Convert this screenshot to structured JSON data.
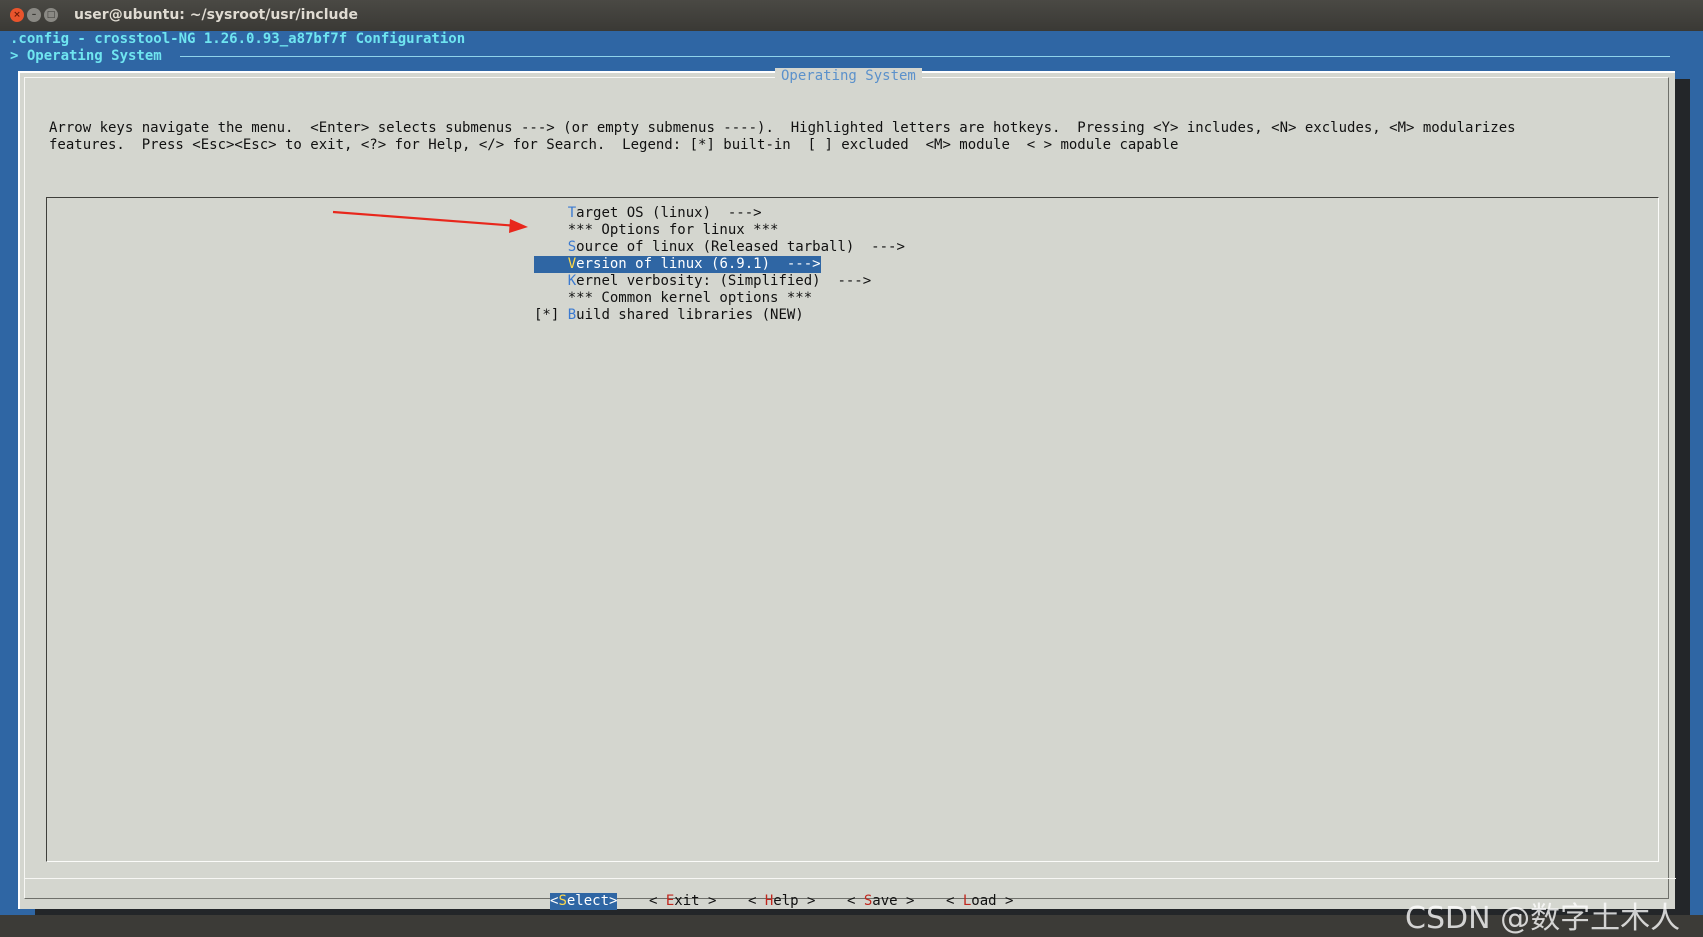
{
  "window": {
    "title": "user@ubuntu: ~/sysroot/usr/include",
    "close_glyph": "×",
    "minimize_glyph": "–",
    "maximize_glyph": "□"
  },
  "terminal": {
    "config_line": ".config - crosstool-NG 1.26.0.93_a87bf7f Configuration",
    "breadcrumb": "> Operating System"
  },
  "dialog": {
    "title": "Operating System",
    "help_line_1": "Arrow keys navigate the menu.  <Enter> selects submenus ---> (or empty submenus ----).  Highlighted letters are hotkeys.  Pressing <Y> includes, <N> excludes, <M> modularizes",
    "help_line_2": "features.  Press <Esc><Esc> to exit, <?> for Help, </> for Search.  Legend: [*] built-in  [ ] excluded  <M> module  < > module capable"
  },
  "menu": {
    "items": [
      {
        "prefix": "    ",
        "hotkey": "T",
        "rest": "arget OS (linux)  --->"
      },
      {
        "prefix": "    ",
        "hotkey": "",
        "rest": "*** Options for linux ***"
      },
      {
        "prefix": "    ",
        "hotkey": "S",
        "rest": "ource of linux (Released tarball)  --->"
      },
      {
        "prefix": "    ",
        "hotkey": "V",
        "rest": "ersion of linux (6.9.1)  --->"
      },
      {
        "prefix": "    ",
        "hotkey": "K",
        "rest": "ernel verbosity: (Simplified)  --->"
      },
      {
        "prefix": "    ",
        "hotkey": "",
        "rest": "*** Common kernel options ***"
      },
      {
        "prefix": "[*] ",
        "hotkey": "B",
        "rest": "uild shared libraries (NEW)"
      }
    ],
    "selected_index": 3
  },
  "buttons": [
    {
      "left": "<",
      "hotkey": "S",
      "rest": "elect",
      "right": ">"
    },
    {
      "left": "< ",
      "hotkey": "E",
      "rest": "xit",
      "right": " >"
    },
    {
      "left": "< ",
      "hotkey": "H",
      "rest": "elp",
      "right": " >"
    },
    {
      "left": "< ",
      "hotkey": "S",
      "rest": "ave",
      "right": " >"
    },
    {
      "left": "< ",
      "hotkey": "L",
      "rest": "oad",
      "right": " >"
    }
  ],
  "colors": {
    "terminal_bg": "#2f66a4",
    "dialog_bg": "#d4d6cf",
    "hotkey": "#3b7ad0",
    "selected_hotkey": "#ffd94a",
    "button_hotkey": "#c0271e",
    "annotation_arrow": "#e8271c"
  },
  "watermark": "CSDN @数字土木人"
}
